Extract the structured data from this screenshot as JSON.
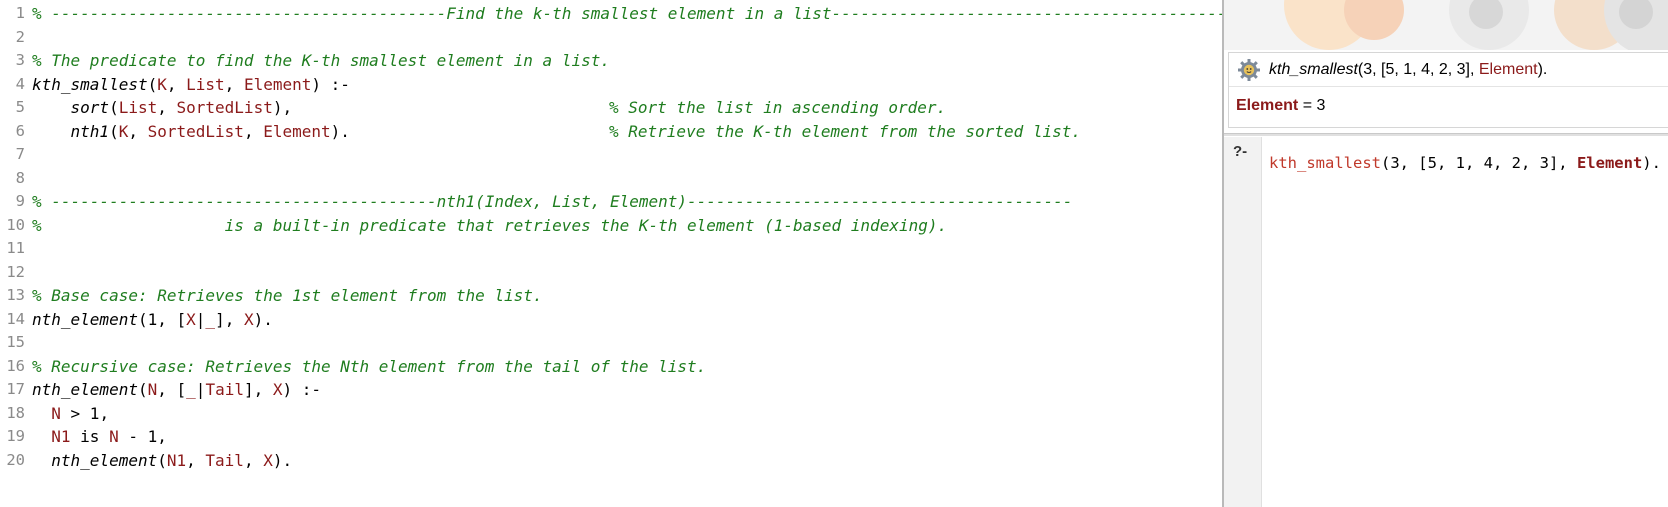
{
  "editor": {
    "lines": [
      {
        "n": "1",
        "comment": "% -----------------------------------------Find the k-th smallest element in a list-----------------------------------------"
      },
      {
        "n": "2"
      },
      {
        "n": "3",
        "comment": "% The predicate to find the K-th smallest element in a list."
      },
      {
        "n": "4",
        "pred": "kth_smallest",
        "open": "(",
        "a1": "K",
        "s1": ", ",
        "a2": "List",
        "s2": ", ",
        "a3": "Element",
        "close": ") :-"
      },
      {
        "n": "5",
        "indent": "    ",
        "pred": "sort",
        "open": "(",
        "a1": "List",
        "s1": ", ",
        "a2": "SortedList",
        "close": "),",
        "trail": "% Sort the list in ascending order."
      },
      {
        "n": "6",
        "indent": "    ",
        "pred": "nth1",
        "open": "(",
        "a1": "K",
        "s1": ", ",
        "a2": "SortedList",
        "s2": ", ",
        "a3": "Element",
        "close": ").",
        "trail": "% Retrieve the K-th element from the sorted list."
      },
      {
        "n": "7"
      },
      {
        "n": "8"
      },
      {
        "n": "9",
        "comment": "% ----------------------------------------nth1(Index, List, Element)----------------------------------------"
      },
      {
        "n": "10",
        "comment": "%                   is a built-in predicate that retrieves the K-th element (1-based indexing)."
      },
      {
        "n": "11"
      },
      {
        "n": "12"
      },
      {
        "n": "13",
        "comment": "% Base case: Retrieves the 1st element from the list."
      },
      {
        "n": "14",
        "pred": "nth_element",
        "open": "(1, [",
        "a1": "X",
        "s1": "|",
        "a2": "_",
        "s2": "], ",
        "a3": "X",
        "close": ")."
      },
      {
        "n": "15"
      },
      {
        "n": "16",
        "comment": "% Recursive case: Retrieves the Nth element from the tail of the list."
      },
      {
        "n": "17",
        "pred": "nth_element",
        "open": "(",
        "a1": "N",
        "s1": ", [",
        "a2": "_",
        "s2": "|",
        "a3": "Tail",
        "close": "], ",
        "a4": "X",
        "close2": ") :-"
      },
      {
        "n": "18",
        "indent": "  ",
        "a1": "N",
        "s1": " > 1,"
      },
      {
        "n": "19",
        "indent": "  ",
        "a1": "N1",
        "s1": " is ",
        "a2": "N",
        "s2": " - 1,"
      },
      {
        "n": "20",
        "indent": "  ",
        "pred": "nth_element",
        "open": "(",
        "a1": "N1",
        "s1": ", ",
        "a2": "Tail",
        "s2": ", ",
        "a3": "X",
        "close": ")."
      }
    ]
  },
  "answer": {
    "query_pred": "kth_smallest",
    "query_args": "(3, [5, 1, 4, 2, 3], ",
    "query_var": "Element",
    "query_end": ").",
    "binding_var": "Element",
    "binding_eq": " = 3"
  },
  "query": {
    "prompt": "?-",
    "pred": "kth_smallest",
    "args": "(3, [5, 1, 4, 2, 3], ",
    "var": "Element",
    "end": ")."
  },
  "icons": {
    "answer_icon": "gear-icon"
  },
  "colors": {
    "comment": "#1f7d1f",
    "variable": "#8b1a1a",
    "query_predicate": "#c0392b"
  }
}
